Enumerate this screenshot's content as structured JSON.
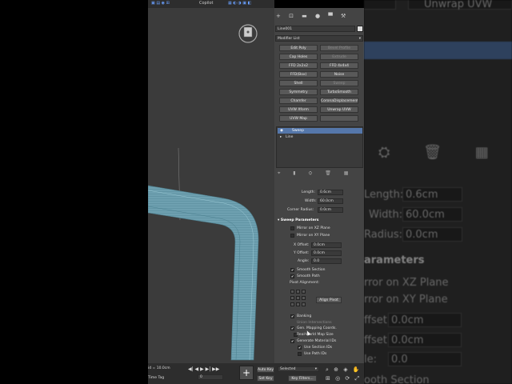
{
  "toolbar": {
    "copilot": "Copilot"
  },
  "panel": {
    "object_name": "Line001",
    "modifier_list": "Modifier List",
    "modifier_buttons": [
      {
        "label": "Edit Poly",
        "enabled": true
      },
      {
        "label": "Bevel Profile",
        "enabled": false
      },
      {
        "label": "Cap Holes",
        "enabled": true
      },
      {
        "label": "Extrude",
        "enabled": false
      },
      {
        "label": "FFD 2x2x2",
        "enabled": true
      },
      {
        "label": "FFD 4x4x4",
        "enabled": true
      },
      {
        "label": "FFD(Box)",
        "enabled": true
      },
      {
        "label": "Noise",
        "enabled": true
      },
      {
        "label": "Shell",
        "enabled": true
      },
      {
        "label": "Sweep",
        "enabled": false
      },
      {
        "label": "Symmetry",
        "enabled": true
      },
      {
        "label": "TurboSmooth",
        "enabled": true
      },
      {
        "label": "Chamfer",
        "enabled": true
      },
      {
        "label": "CoronaDisplacementMod",
        "enabled": true
      },
      {
        "label": "UVW Xform",
        "enabled": true
      },
      {
        "label": "Unwrap UVW",
        "enabled": true
      },
      {
        "label": "UVW Map",
        "enabled": true
      },
      {
        "label": "",
        "enabled": false
      }
    ],
    "stack": {
      "selected": "Sweep",
      "item": "Line"
    },
    "section_params": {
      "length_label": "Length:",
      "length": "0.6cm",
      "width_label": "Width:",
      "width": "60.0cm",
      "corner_label": "Corner Radius:",
      "corner": "0.0cm"
    },
    "sweep": {
      "title": "Sweep Parameters",
      "mirror_xz": "Mirror on XZ Plane",
      "mirror_xy": "Mirror on XY Plane",
      "x_offset_label": "X Offset:",
      "x_offset": "0.0cm",
      "y_offset_label": "Y Offset:",
      "y_offset": "0.0cm",
      "angle_label": "Angle:",
      "angle": "0.0",
      "smooth_section": "Smooth Section",
      "smooth_path": "Smooth Path",
      "pivot_alignment": "Pivot Alignment:",
      "align_pivot": "Align Pivot",
      "banking": "Banking",
      "union": "Union Intersections",
      "gen_mapping": "Gen. Mapping Coords.",
      "real_world": "Real-World Map Size",
      "gen_material": "Generate Material IDs",
      "use_section": "Use Section IDs",
      "use_path": "Use Path IDs"
    }
  },
  "bottom": {
    "grid": "id = 10.0cm",
    "time_tag": "Time Tag",
    "auto_key": "Auto Key",
    "selected": "Selected",
    "set_key": "Set Key",
    "key_filters": "Key Filters...",
    "frame": "0"
  },
  "background": {
    "unwrap": "Unwrap UVW",
    "length_label": "Length:",
    "length": "0.6cm",
    "width_label": "Width:",
    "width": "60.0cm",
    "radius_label": "Radius:",
    "radius": "0.0cm",
    "params_title": "arameters",
    "mirror_xz": "rror on XZ Plane",
    "mirror_xy": "rror on XY Plane",
    "offset1_label": "ffset:",
    "offset1": "0.0cm",
    "offset2_label": "ffset:",
    "offset2": "0.0cm",
    "angle_label": "le:",
    "angle": "0.0",
    "smooth": "ooth Section"
  }
}
